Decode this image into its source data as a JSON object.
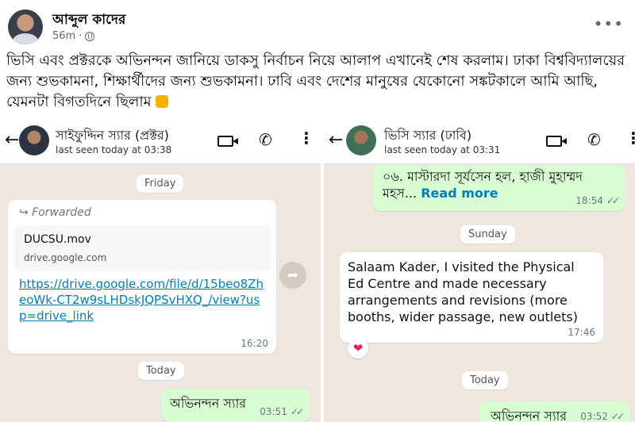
{
  "post": {
    "author": "আব্দুল কাদের",
    "time": "56m",
    "separator": "·",
    "more_icon": "•••",
    "text": "ভিসি এবং প্রক্টরকে অভিনন্দন জানিয়ে ডাকসু নির্বাচন নিয়ে আলাপ এখানেই শেষ করলাম। ঢাকা বিশ্ববিদ্যালয়ের জন্য শুভকামনা, শিক্ষার্থীদের জন্য শুভকামনা। ঢাবি এবং দেশের মানুষের যেকোনো সঙ্কটকালে আমি আছি, যেমনটা বিগতদিনে ছিলাম",
    "emoji_icon": "raised-fist-icon"
  },
  "left_chat": {
    "back_glyph": "←",
    "contact_name": "সাইফুদ্দিন স্যার (প্রক্টর)",
    "last_seen": "last seen today at 03:38",
    "phone_glyph": "✆",
    "kebab_glyph": "⋮",
    "day1": "Friday",
    "forwarded": "Forwarded",
    "forward_glyph": "↪",
    "file_name": "DUCSU.mov",
    "file_host": "drive.google.com",
    "link": "https://drive.google.com/file/d/15beo8ZheoWk-CT2w9sLHDskJQPSvHXQ_/view?usp=drive_link",
    "link_time": "16:20",
    "share_glyph": "➦",
    "day2": "Today",
    "reply_text": "অভিনন্দন স্যার",
    "reply_time": "03:51",
    "tick_glyph": "✓✓"
  },
  "right_chat": {
    "back_glyph": "←",
    "contact_name": "ভিসি স্যার (ঢাবি)",
    "last_seen": "last seen today at 03:31",
    "phone_glyph": "✆",
    "kebab_glyph": "⋮",
    "prev_text": "০৬. মাস্টারদা সূর্যসেন হল, হাজী মুহাম্মদ মহস...",
    "read_more": "Read more",
    "prev_time": "18:54",
    "day1": "Sunday",
    "msg_text": "Salaam Kader, I visited the Physical Ed Centre and made necessary arrangements and revisions (more booths, wider passage, new outlets)",
    "msg_time": "17:46",
    "reaction_glyph": "❤",
    "day2": "Today",
    "reply_text": "অভিনন্দন স্যার",
    "reply_time": "03:52",
    "tick_glyph": "✓✓"
  }
}
